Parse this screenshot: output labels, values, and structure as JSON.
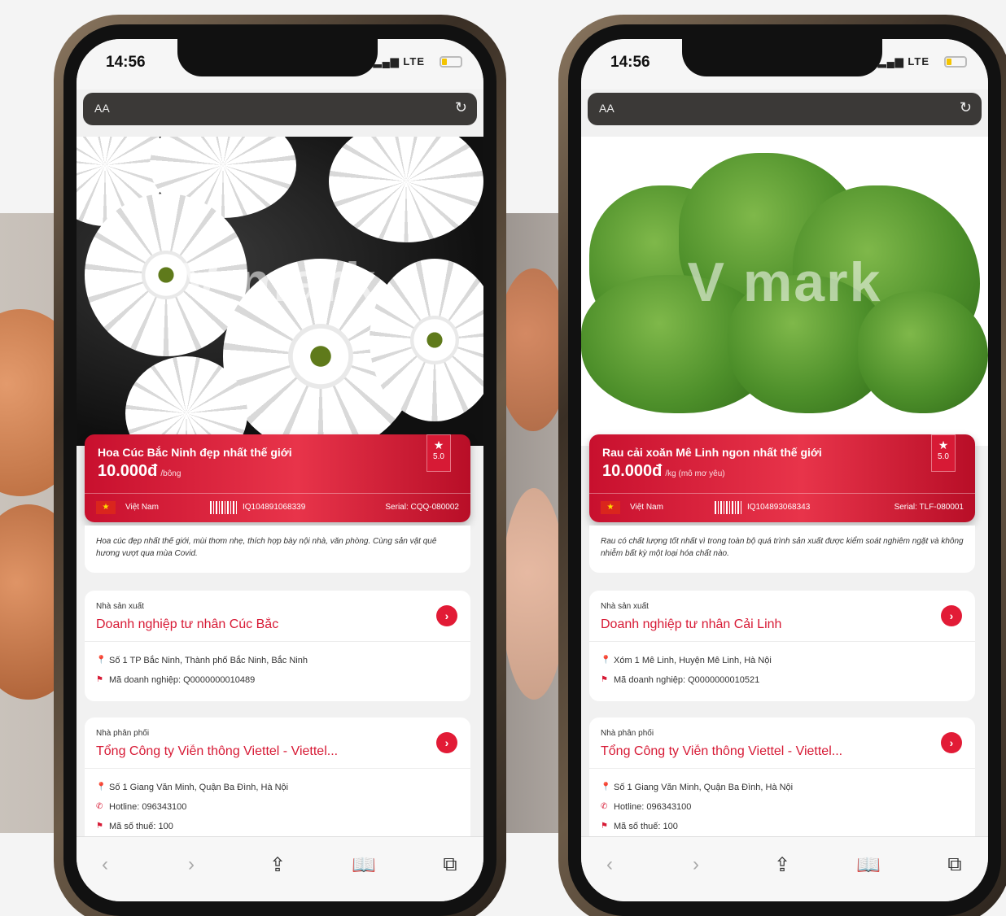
{
  "phones": [
    {
      "status": {
        "time": "14:56",
        "network": "LTE"
      },
      "browser": {
        "text_size_label": "AA"
      },
      "product": {
        "watermark": "V mark",
        "name": "Hoa Cúc Bắc Ninh đẹp nhất thế giới",
        "price": "10.000đ",
        "unit": "/bông",
        "rating": "5.0",
        "origin_country": "Việt Nam",
        "code": "IQ104891068339",
        "serial": "Serial: CQQ-080002",
        "description": "Hoa cúc đẹp nhất thế giới, mùi thơm nhẹ, thích hợp bày nội nhà, văn phòng. Cùng sản vật quê hương vượt qua mùa Covid."
      },
      "producer": {
        "label": "Nhà sản xuất",
        "name": "Doanh nghiệp tư nhân Cúc Bắc",
        "address": "Số 1 TP Bắc Ninh, Thành phố Bắc Ninh, Bắc Ninh",
        "business_id": "Mã doanh nghiệp: Q0000000010489"
      },
      "distributor": {
        "label": "Nhà phân phối",
        "name": "Tổng Công ty Viễn thông Viettel - Viettel...",
        "address": "Số 1 Giang Văn Minh, Quận Ba Đình, Hà Nội",
        "hotline": "Hotline: 096343100",
        "tax_id": "Mã số thuế: 100"
      }
    },
    {
      "status": {
        "time": "14:56",
        "network": "LTE"
      },
      "browser": {
        "text_size_label": "AA"
      },
      "product": {
        "watermark": "V mark",
        "name": "Rau cải xoăn Mê Linh ngon nhất thế giới",
        "price": "10.000đ",
        "unit": "/kg (mô mơ yêu)",
        "rating": "5.0",
        "origin_country": "Việt Nam",
        "code": "IQ104893068343",
        "serial": "Serial: TLF-080001",
        "description": "Rau có chất lượng tốt nhất vì trong toàn bộ quá trình sản xuất được kiểm soát nghiêm ngặt và không nhiễm bất kỳ một loại hóa chất nào."
      },
      "producer": {
        "label": "Nhà sản xuất",
        "name": "Doanh nghiệp tư nhân Cải Linh",
        "address": "Xóm 1 Mê Linh, Huyện Mê Linh, Hà Nội",
        "business_id": "Mã doanh nghiệp: Q0000000010521"
      },
      "distributor": {
        "label": "Nhà phân phối",
        "name": "Tổng Công ty Viễn thông Viettel - Viettel...",
        "address": "Số 1 Giang Văn Minh, Quận Ba Đình, Hà Nội",
        "hotline": "Hotline: 096343100",
        "tax_id": "Mã số thuế: 100"
      }
    }
  ],
  "icons": {
    "reload": "reload-icon",
    "back": "chevron-left-icon",
    "forward": "chevron-right-icon",
    "share": "share-icon",
    "bookmarks": "book-icon",
    "tabs": "tabs-icon",
    "location": "pin-icon",
    "phone": "phone-icon",
    "flag": "vietnam-flag-icon"
  },
  "colors": {
    "brand_red": "#d71a35",
    "link_red": "#e21b36"
  }
}
